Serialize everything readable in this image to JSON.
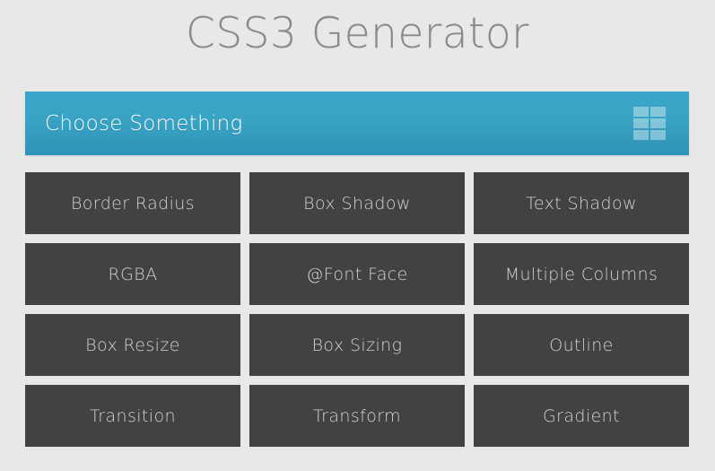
{
  "page": {
    "title": "CSS3 Generator",
    "background_color": "#e8e8e8",
    "title_color": "#8b8b8b"
  },
  "panel": {
    "header": {
      "title": "Choose Something",
      "icon": "grid-icon",
      "icon_cells": 6,
      "background_color_top": "#3ba7c8",
      "background_color_bottom": "#2f93b6",
      "text_color": "#ffffff"
    },
    "tile_background_color": "#424242",
    "tile_text_color": "#d2d2d2",
    "tiles": [
      {
        "label": "Border Radius"
      },
      {
        "label": "Box Shadow"
      },
      {
        "label": "Text Shadow"
      },
      {
        "label": "RGBA"
      },
      {
        "label": "@Font Face"
      },
      {
        "label": "Multiple Columns"
      },
      {
        "label": "Box Resize"
      },
      {
        "label": "Box Sizing"
      },
      {
        "label": "Outline"
      },
      {
        "label": "Transition"
      },
      {
        "label": "Transform"
      },
      {
        "label": "Gradient"
      }
    ]
  }
}
